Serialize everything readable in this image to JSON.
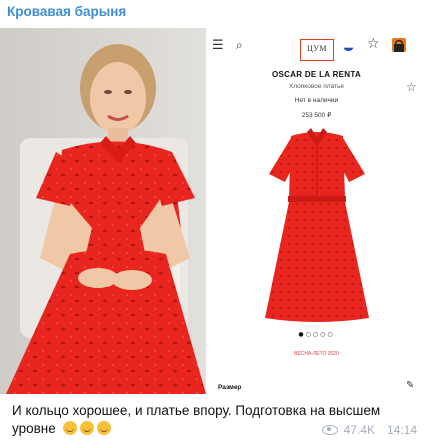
{
  "channel": {
    "name": "Кровавая барыня"
  },
  "product": {
    "logo_text": "ЦУМ",
    "brand": "OSCAR DE LA RENTA",
    "subtitle": "Хлопковое платье",
    "stock": "Нет в наличии",
    "price": "253 500 ₽",
    "season": "ВЕСНА-ЛЕТО 2020",
    "size_label": "Размер",
    "carousel_dots": "●○○○○"
  },
  "post": {
    "caption": "И кольцо хорошее, и платье впору. Подготовка на высшем уровне",
    "views": "47.4K",
    "time": "14:14"
  },
  "colors": {
    "dress_red": "#e8251e",
    "channel_blue": "#3f8fd0",
    "accent_orange": "#e04020"
  },
  "icons": {
    "menu": "menu-icon",
    "search": "search-icon",
    "flag": "russia-flag-icon",
    "star": "star-icon",
    "bag": "shopping-bag-icon",
    "edit": "pencil-icon",
    "views": "eye-icon"
  }
}
